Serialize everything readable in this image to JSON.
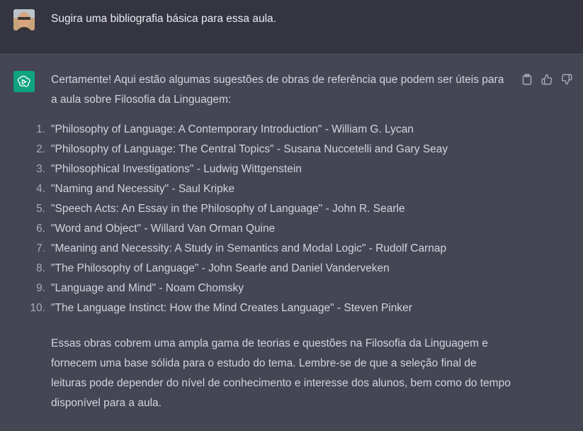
{
  "user_message": {
    "text": "Sugira uma bibliografia básica para essa aula."
  },
  "assistant_message": {
    "intro": "Certamente! Aqui estão algumas sugestões de obras de referência que podem ser úteis para a aula sobre Filosofia da Linguagem:",
    "references": [
      {
        "number": "1.",
        "text": "\"Philosophy of Language: A Contemporary Introduction\" - William G. Lycan"
      },
      {
        "number": "2.",
        "text": "\"Philosophy of Language: The Central Topics\" - Susana Nuccetelli and Gary Seay"
      },
      {
        "number": "3.",
        "text": "\"Philosophical Investigations\" - Ludwig Wittgenstein"
      },
      {
        "number": "4.",
        "text": "\"Naming and Necessity\" - Saul Kripke"
      },
      {
        "number": "5.",
        "text": "\"Speech Acts: An Essay in the Philosophy of Language\" - John R. Searle"
      },
      {
        "number": "6.",
        "text": "\"Word and Object\" - Willard Van Orman Quine"
      },
      {
        "number": "7.",
        "text": "\"Meaning and Necessity: A Study in Semantics and Modal Logic\" - Rudolf Carnap"
      },
      {
        "number": "8.",
        "text": "\"The Philosophy of Language\" - John Searle and Daniel Vanderveken"
      },
      {
        "number": "9.",
        "text": "\"Language and Mind\" - Noam Chomsky"
      },
      {
        "number": "10.",
        "text": "\"The Language Instinct: How the Mind Creates Language\" - Steven Pinker"
      }
    ],
    "closing": "Essas obras cobrem uma ampla gama de teorias e questões na Filosofia da Linguagem e fornecem uma base sólida para o estudo do tema. Lembre-se de que a seleção final de leituras pode depender do nível de conhecimento e interesse dos alunos, bem como do tempo disponível para a aula."
  },
  "icons": {
    "user_avatar": "user-avatar-photo",
    "assistant_avatar": "openai-logo-icon",
    "copy": "clipboard-icon",
    "like": "thumbs-up-icon",
    "dislike": "thumbs-down-icon"
  },
  "colors": {
    "user_bg": "#343541",
    "assistant_bg": "#444654",
    "assistant_avatar_bg": "#10a37f",
    "text": "#d1d5db"
  }
}
